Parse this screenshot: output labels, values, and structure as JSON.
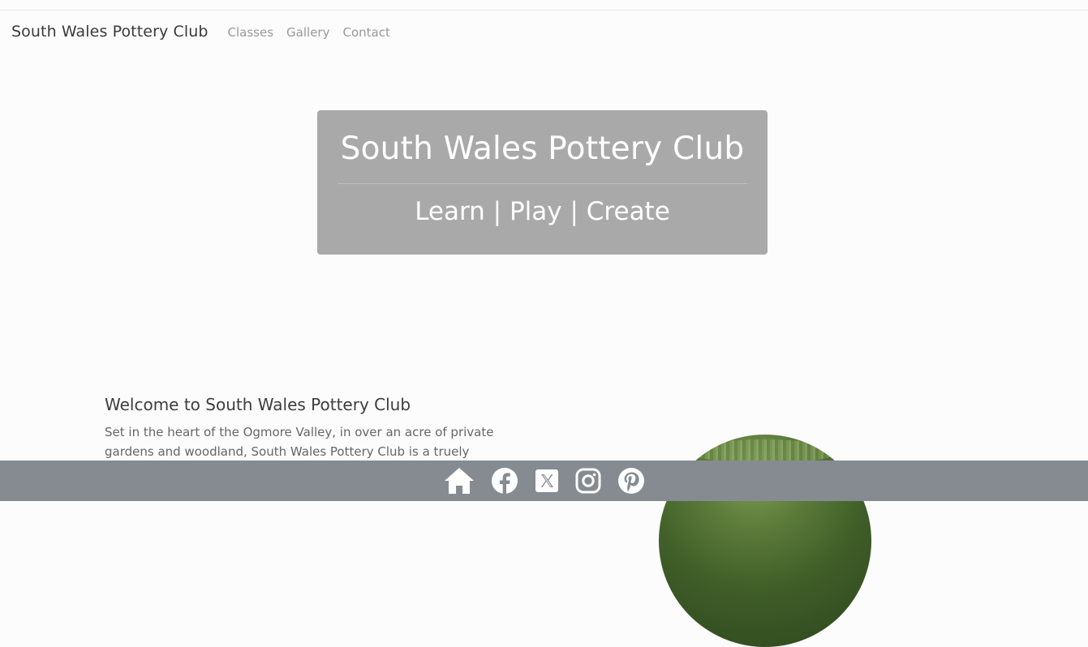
{
  "navbar": {
    "brand": "South Wales Pottery Club",
    "links": [
      "Classes",
      "Gallery",
      "Contact"
    ]
  },
  "hero": {
    "title": "South Wales Pottery Club",
    "subtitle": "Learn | Play | Create"
  },
  "welcome": {
    "heading": "Welcome to South Wales Pottery Club",
    "body": "Set in the heart of the Ogmore Valley, in over an acre of private gardens and woodland, South Wales Pottery Club is a truely"
  },
  "footer": {
    "icons": [
      "home-icon",
      "facebook-icon",
      "x-twitter-icon",
      "instagram-icon",
      "pinterest-icon"
    ]
  },
  "colors": {
    "hero_background": "#a9a9a9",
    "footer_background": "#858b91",
    "page_background": "#fcfcfc"
  }
}
